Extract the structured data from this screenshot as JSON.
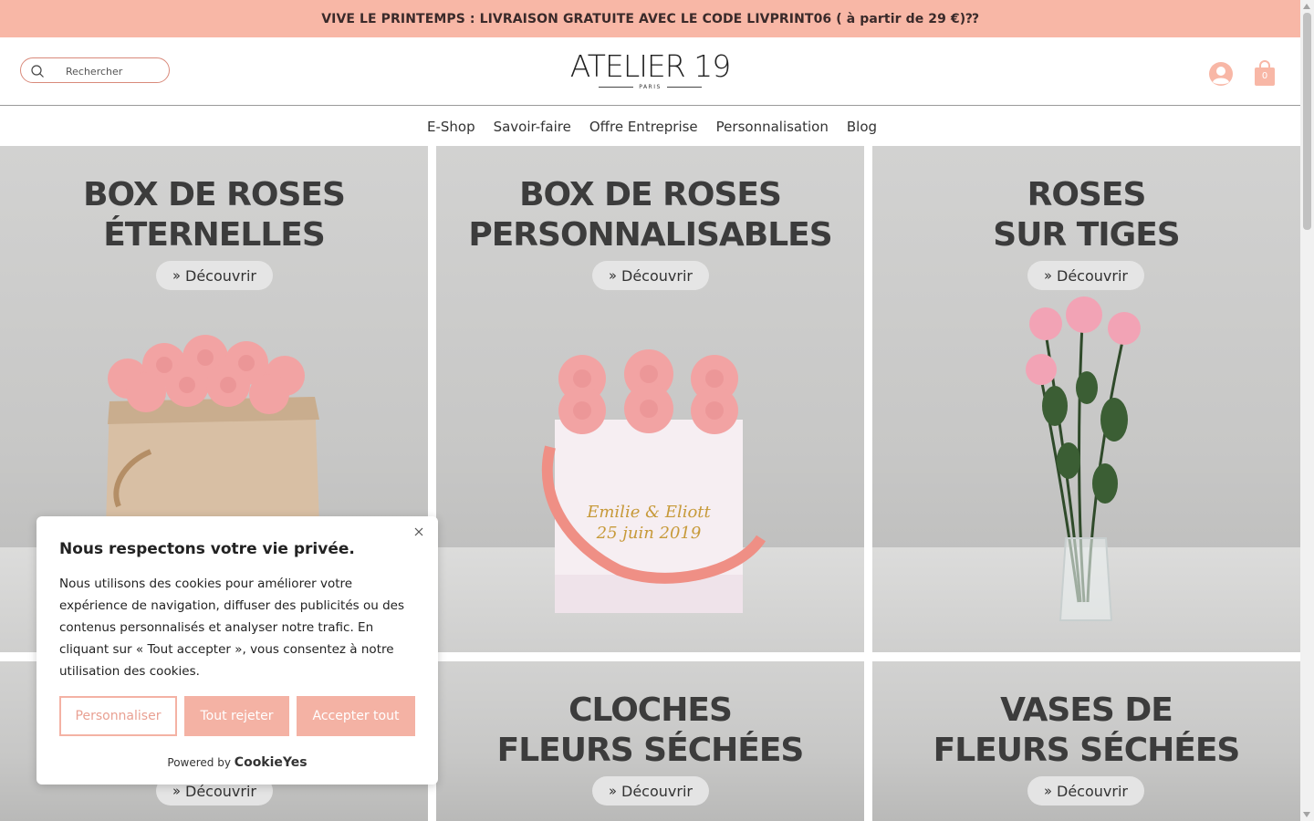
{
  "promo": {
    "text": "VIVE LE PRINTEMPS : LIVRAISON GRATUITE AVEC LE CODE LIVPRINT06 ( à partir de 29 €)⁇"
  },
  "header": {
    "search_placeholder": "Rechercher",
    "logo": {
      "name": "ATELIER 19",
      "subtitle": "PARIS"
    },
    "cart_count": "0",
    "accent_color": "#f8b7a6"
  },
  "nav": {
    "items": [
      {
        "label": "E-Shop"
      },
      {
        "label": "Savoir-faire"
      },
      {
        "label": "Offre Entreprise"
      },
      {
        "label": "Personnalisation"
      },
      {
        "label": "Blog"
      }
    ]
  },
  "tiles": [
    {
      "line1": "BOX DE ROSES",
      "line2": "ÉTERNELLES",
      "button": "Découvrir"
    },
    {
      "line1": "BOX DE ROSES",
      "line2": "PERSONNALISABLES",
      "button": "Découvrir",
      "box_text_1": "Emilie & Eliott",
      "box_text_2": "25 juin 2019"
    },
    {
      "line1": "ROSES",
      "line2": "SUR TIGES",
      "button": "Découvrir"
    },
    {
      "line1": "",
      "line2": "",
      "button": "Découvrir"
    },
    {
      "line1": "CLOCHES",
      "line2": "FLEURS SÉCHÉES",
      "button": "Découvrir"
    },
    {
      "line1": "VASES DE",
      "line2": "FLEURS SÉCHÉES",
      "button": "Découvrir"
    }
  ],
  "cookie": {
    "title": "Nous respectons votre vie privée.",
    "text": "Nous utilisons des cookies pour améliorer votre expérience de navigation, diffuser des publicités ou des contenus personnalisés et analyser notre trafic. En cliquant sur « Tout accepter », vous consentez à notre utilisation des cookies.",
    "btn_customize": "Personnaliser",
    "btn_reject": "Tout rejeter",
    "btn_accept": "Accepter tout",
    "powered_by": "Powered by",
    "brand": "CookieYes"
  }
}
